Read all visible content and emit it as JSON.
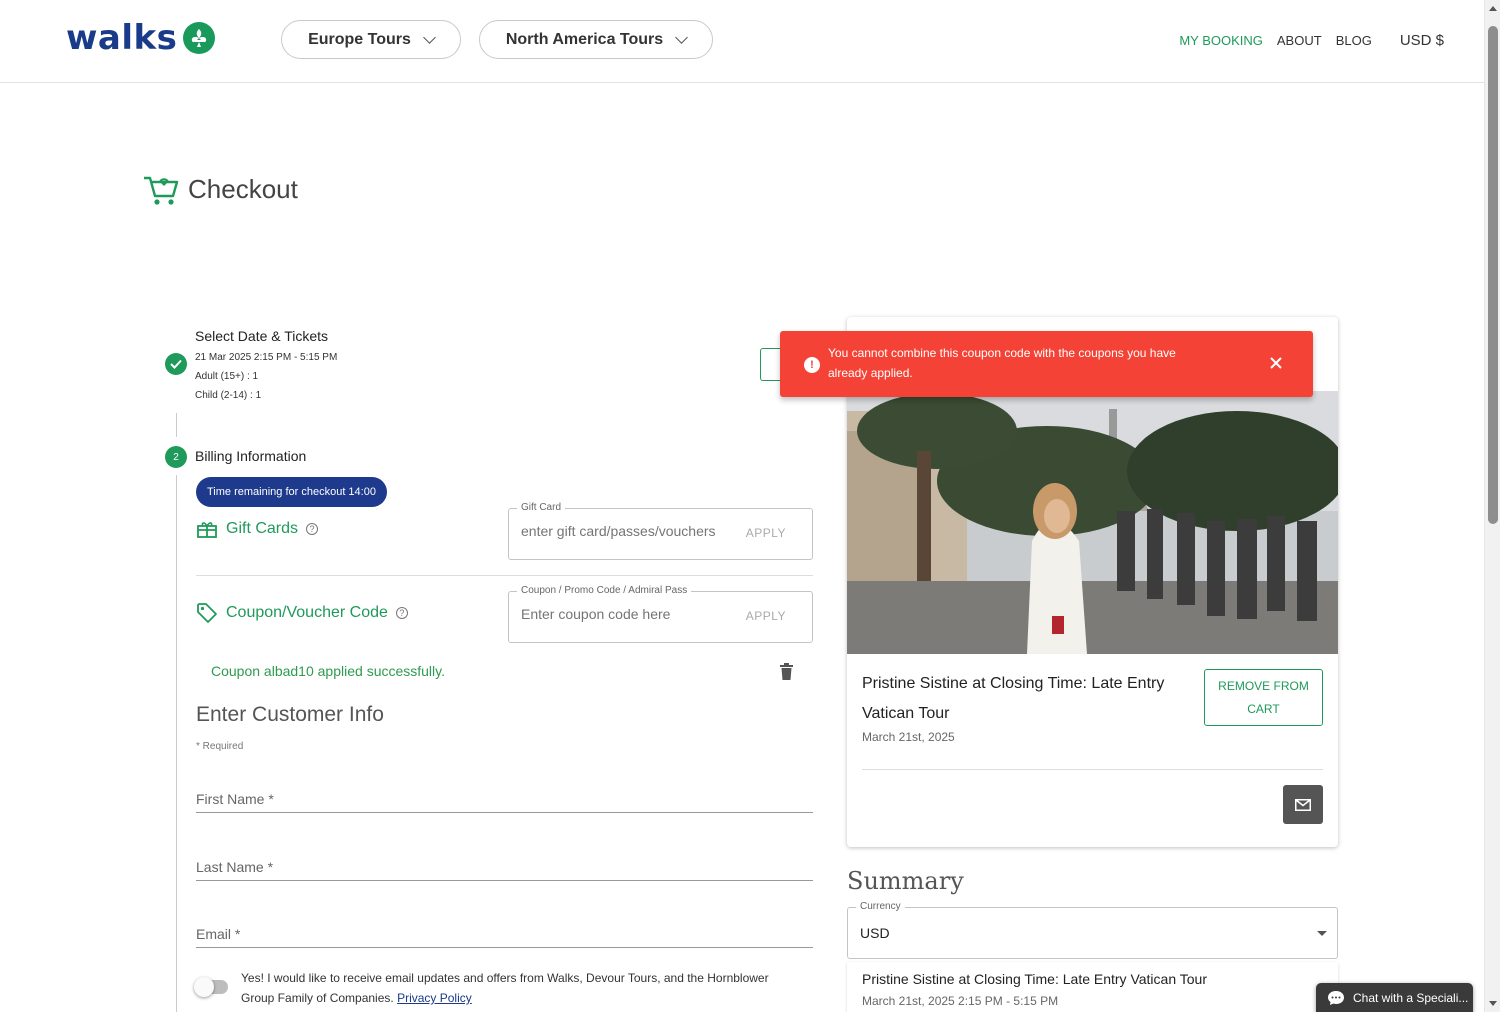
{
  "brand": {
    "name": "walks",
    "accent": "#1f9a5a",
    "primary": "#1d3a8c"
  },
  "nav": {
    "tours": [
      {
        "label": "Europe Tours"
      },
      {
        "label": "North America Tours"
      }
    ],
    "links": {
      "my_booking": "MY BOOKING",
      "about": "ABOUT",
      "blog": "BLOG"
    },
    "currency": "USD $"
  },
  "checkout": {
    "title": "Checkout"
  },
  "steps": {
    "step1": {
      "title": "Select Date & Tickets",
      "date": "21 Mar 2025 2:15 PM - 5:15 PM",
      "adult": "Adult (15+) : 1",
      "child": "Child (2-14) : 1"
    },
    "step2": {
      "number": "2",
      "title": "Billing Information"
    }
  },
  "timer": "Time remaining for checkout 14:00",
  "gift_card": {
    "label": "Gift Cards",
    "legend": "Gift Card",
    "placeholder": "enter gift card/passes/vouchers",
    "apply": "APPLY"
  },
  "coupon": {
    "label": "Coupon/Voucher Code",
    "legend": "Coupon / Promo Code / Admiral Pass",
    "placeholder": "Enter coupon code here",
    "apply": "APPLY",
    "success": "Coupon albad10 applied successfully."
  },
  "customer": {
    "heading": "Enter Customer Info",
    "required_note": "* Required",
    "first_name": "First Name *",
    "last_name": "Last Name *",
    "email": "Email *",
    "consent": "Yes! I would like to receive email updates and offers from Walks, Devour Tours, and the Hornblower Group Family of Companies.",
    "privacy": "Privacy Policy"
  },
  "toast": {
    "message": "You cannot combine this coupon code with the coupons you have already applied."
  },
  "cart": {
    "tour_title": "Pristine Sistine at Closing Time: Late Entry Vatican Tour",
    "tour_date": "March 21st, 2025",
    "remove": "REMOVE FROM CART"
  },
  "summary": {
    "title": "Summary",
    "currency_legend": "Currency",
    "currency_value": "USD",
    "item_name": "Pristine Sistine at Closing Time: Late Entry Vatican Tour",
    "item_when": "March 21st, 2025 2:15 PM - 5:15 PM"
  },
  "chat": {
    "label": "Chat with a Speciali..."
  }
}
